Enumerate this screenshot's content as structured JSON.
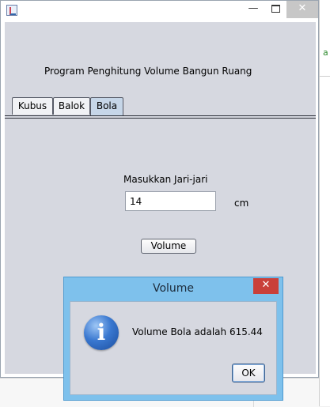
{
  "window": {
    "title": "",
    "controls": {
      "minimize": "—",
      "maximize_icon": "maximize-icon",
      "close": "✕"
    }
  },
  "background": {
    "side_text": "a"
  },
  "app": {
    "heading": "Program Penghitung Volume Bangun Ruang",
    "tabs": [
      {
        "label": "Kubus",
        "active": false
      },
      {
        "label": "Balok",
        "active": false
      },
      {
        "label": "Bola",
        "active": true
      }
    ],
    "form": {
      "label": "Masukkan Jari-jari",
      "input_value": "14",
      "unit": "cm",
      "button_label": "Volume"
    }
  },
  "dialog": {
    "title": "Volume",
    "close": "✕",
    "icon": "info-icon",
    "message": "Volume Bola adalah 615.44",
    "ok_label": "OK"
  },
  "colors": {
    "content_bg": "#d6d8e0",
    "dialog_frame": "#7ec1ec",
    "dialog_close": "#c9403a",
    "active_tab": "#c6d6e8"
  }
}
